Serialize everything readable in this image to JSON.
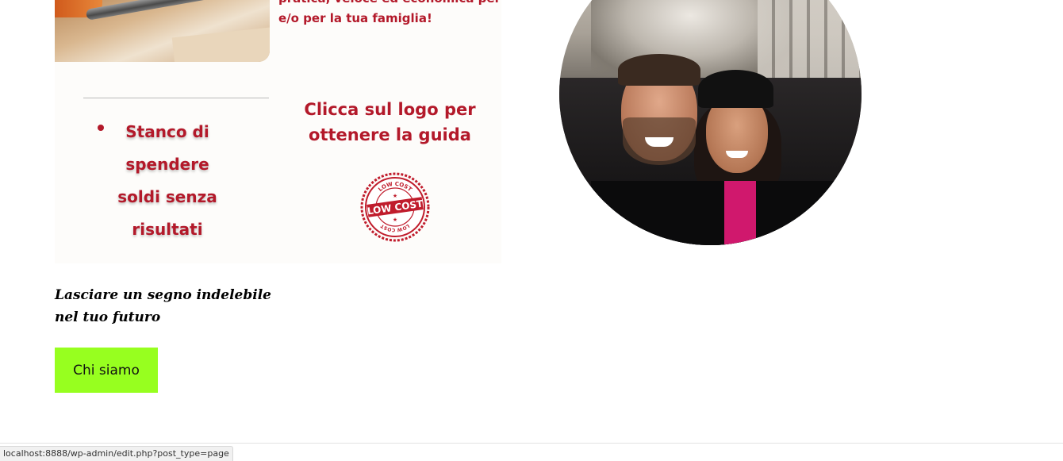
{
  "promo": {
    "top_text_line1": "pratica, veloce ed economica per te",
    "top_text_line2": "e/o per la tua famiglia!",
    "bullet_text": "Stanco di\nspendere\nsoldi senza\nrisultati",
    "cta_text": "Clicca  sul logo per\nottenere la guida",
    "logo": {
      "top_label": "LOW COST",
      "center_label": "LOW COST",
      "bottom_label": "LOW COST",
      "color": "#c01c2c"
    },
    "accent_color": "#b3192a"
  },
  "content": {
    "tagline": "Lasciare un segno indelebile nel tuo futuro",
    "button_label": "Chi siamo",
    "button_color": "#97ff1f"
  },
  "statusbar": {
    "url": "localhost:8888/wp-admin/edit.php?post_type=page"
  }
}
